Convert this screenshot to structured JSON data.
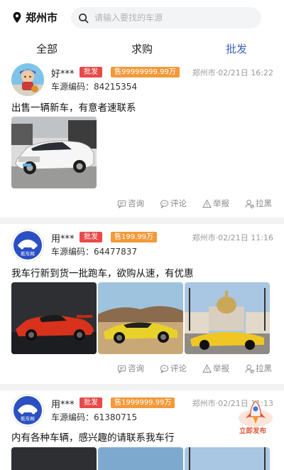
{
  "header": {
    "city": "郑州市",
    "search_placeholder": "请输入要找的车源"
  },
  "tabs": [
    {
      "label": "全部"
    },
    {
      "label": "求购"
    },
    {
      "label": "批发"
    }
  ],
  "posts": [
    {
      "user": "好***",
      "tag": "批发",
      "price": "售99999999.99万",
      "city_time": "郑州市·02/21日 16:22",
      "code": "车源编码：84215354",
      "desc": "出售一辆新车，有意者速联系",
      "images": [
        "white-sedan"
      ]
    },
    {
      "user": "用***",
      "tag": "批发",
      "price": "售199.99万",
      "city_time": "郑州市·02/21日 11:16",
      "code": "车源编码：64477837",
      "desc": "我车行新到货一批跑车，欲购从速，有优惠",
      "avatar_text": "乾车网",
      "images": [
        "red-supercar",
        "yellow-lamborghini",
        "yellow-ferrari"
      ]
    },
    {
      "user": "用***",
      "tag": "批发",
      "price": "售1999999.99万",
      "city_time": "郑州市·02/21日 11:13",
      "code": "车源编码：61380715",
      "desc": "内有各种车辆，感兴趣的请联系我车行",
      "avatar_text": "乾车网"
    }
  ],
  "actions": {
    "consult": "咨询",
    "comment": "评论",
    "report": "举报",
    "block": "拉黑"
  },
  "fab": {
    "label": "立即发布"
  }
}
